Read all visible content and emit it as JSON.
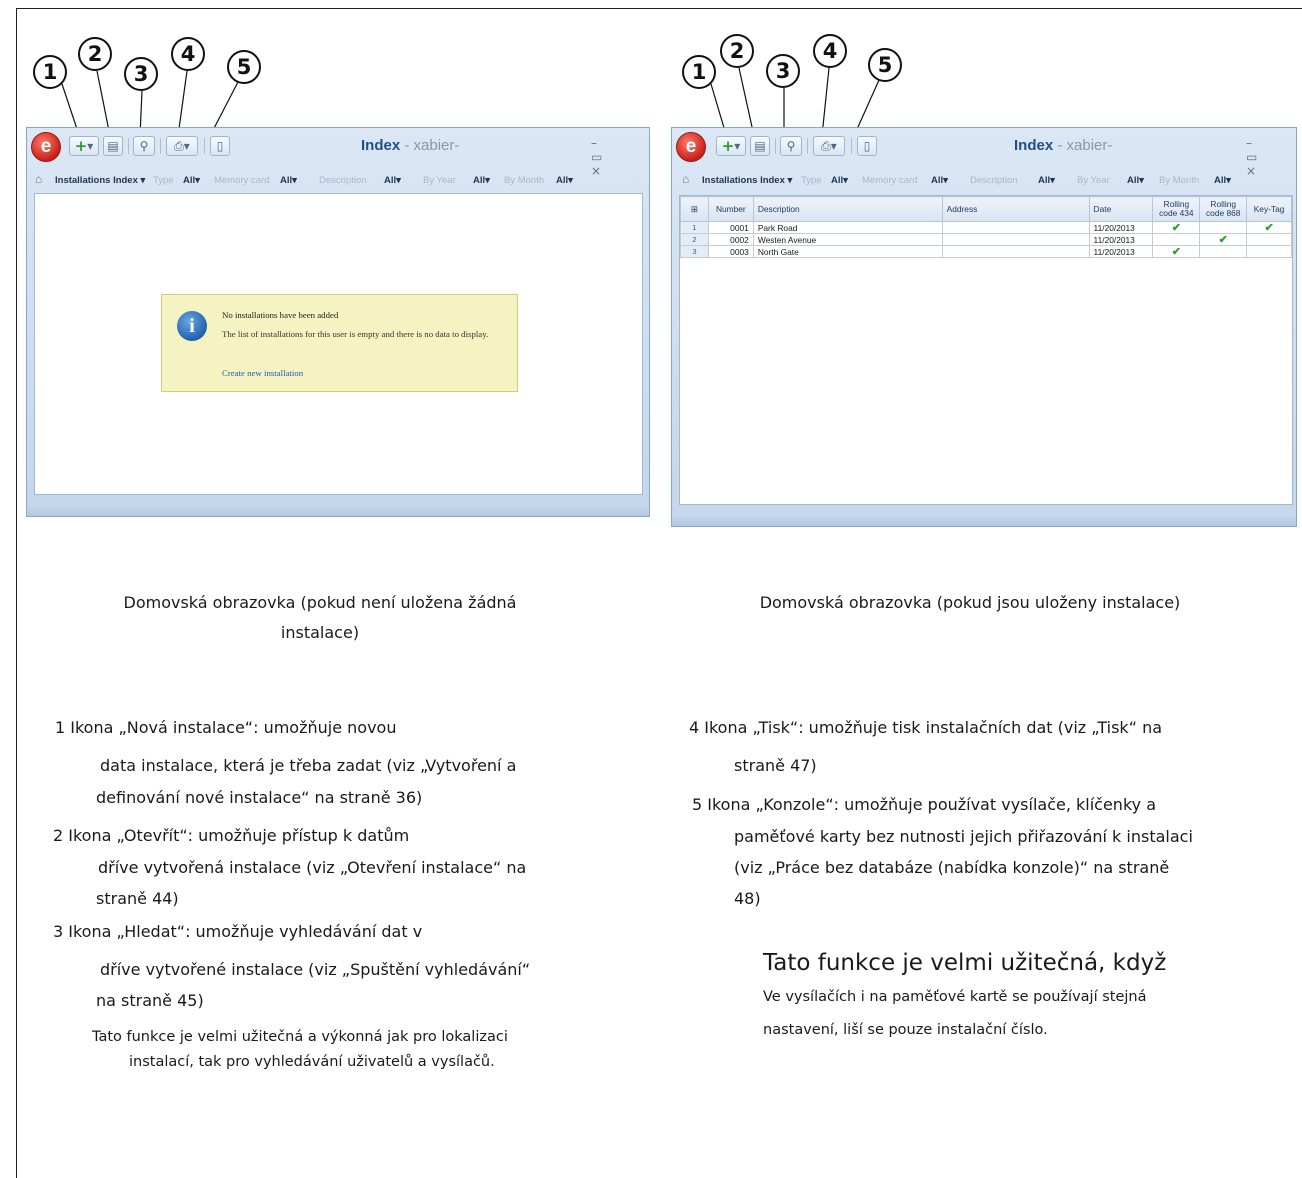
{
  "callouts": [
    "1",
    "2",
    "3",
    "4",
    "5"
  ],
  "app_window": {
    "title_bold": "Index",
    "title_rest": " - xabier-",
    "logo_letter": "e",
    "controls": "– ▭ ×",
    "filters": {
      "root": "Installations Index",
      "type": "Type",
      "memory_card": "Memory card",
      "description": "Description",
      "by_year": "By Year",
      "by_month": "By Month",
      "all": "All"
    }
  },
  "notice": {
    "title": "No installations have been added",
    "body": "The list of installations for this user is empty and there is no data to display.",
    "link": "Create new installation"
  },
  "grid": {
    "columns": [
      "Number",
      "Description",
      "Address",
      "Date",
      "Rolling code 434",
      "Rolling code 868",
      "Key-Tag"
    ],
    "check_mark": "✔",
    "rows": [
      {
        "index": "1",
        "number": "0001",
        "description": "Park Road",
        "address": "",
        "date": "11/20/2013",
        "rc434": true,
        "rc868": false,
        "keytag": true
      },
      {
        "index": "2",
        "number": "0002",
        "description": "Westen Avenue",
        "address": "",
        "date": "11/20/2013",
        "rc434": false,
        "rc868": true,
        "keytag": false
      },
      {
        "index": "3",
        "number": "0003",
        "description": "North Gate",
        "address": "",
        "date": "11/20/2013",
        "rc434": true,
        "rc868": false,
        "keytag": false
      }
    ]
  },
  "captions": {
    "left_line1": "Domovská obrazovka (pokud není uložena žádná",
    "left_line2": "instalace)",
    "right": "Domovská obrazovka (pokud jsou uloženy instalace)"
  },
  "left_text": {
    "item1_line1": "1 Ikona „Nová instalace“: umožňuje novou",
    "item1_line2": "data instalace, která je třeba zadat (viz „Vytvoření a",
    "item1_line3": "definování nové instalace“ na straně 36)",
    "item2_line1": "2 Ikona „Otevřít“: umožňuje přístup k datům",
    "item2_line2": "dříve vytvořená instalace (viz „Otevření instalace“ na",
    "item2_line3": "straně 44)",
    "item3_line1": "3 Ikona „Hledat“: umožňuje vyhledávání dat v",
    "item3_line2": "dříve vytvořené instalace (viz „Spuštění vyhledávání“",
    "item3_line3": "na straně 45)",
    "note_line1": "Tato funkce je velmi užitečná a výkonná jak pro lokalizaci",
    "note_line2": "instalací, tak pro vyhledávání uživatelů a vysílačů."
  },
  "right_text": {
    "item4_line1": "4 Ikona „Tisk“: umožňuje tisk instalačních dat (viz „Tisk“ na",
    "item4_line2": "straně 47)",
    "item5_line1": "5 Ikona „Konzole“: umožňuje používat vysílače, klíčenky a",
    "item5_line2": "paměťové karty bez nutnosti jejich přiřazování k instalaci",
    "item5_line3": "(viz „Práce bez databáze (nabídka konzole)“ na straně",
    "item5_line4": "48)",
    "heading": "Tato funkce je velmi užitečná, když",
    "note_line1": "Ve vysílačích i na paměťové kartě se používají stejná",
    "note_line2": "nastavení, liší se pouze instalační číslo."
  }
}
